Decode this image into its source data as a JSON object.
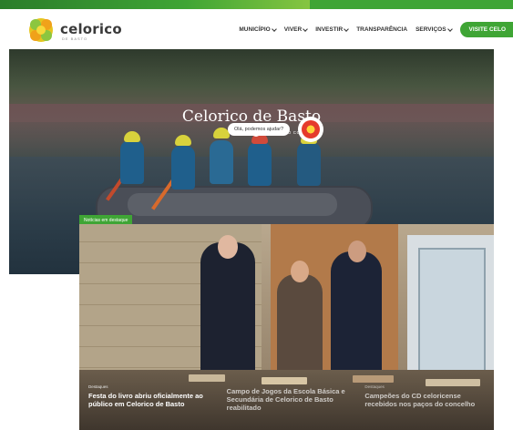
{
  "header": {
    "logo_text": "celorico",
    "logo_sub": "DE BASTO",
    "nav": [
      {
        "label": "MUNICÍPIO",
        "dropdown": true
      },
      {
        "label": "VIVER",
        "dropdown": true
      },
      {
        "label": "INVESTIR",
        "dropdown": true
      },
      {
        "label": "TRANSPARÊNCIA",
        "dropdown": false
      },
      {
        "label": "SERVIÇOS",
        "dropdown": true
      }
    ],
    "visit_button": "VISITE CELO"
  },
  "hero": {
    "title": "Celorico de Basto",
    "video_label": "VER VÍDEO COMPLETO"
  },
  "chat": {
    "bubble": "Olá, podemos ajudar?"
  },
  "news": {
    "tag": "Notícias em destaque",
    "articles": [
      {
        "category": "Destaques",
        "title": "Festa do livro abriu oficialmente ao público em Celorico de Basto"
      },
      {
        "category": "",
        "title": "Campo de Jogos da Escola Básica e Secundária de Celorico de Basto reabilitado"
      },
      {
        "category": "Destaques",
        "title": "Campeões do CD celoricense recebidos nos paços do concelho"
      }
    ]
  },
  "colors": {
    "brand_green": "#3fa535",
    "nav_text": "#333333"
  }
}
